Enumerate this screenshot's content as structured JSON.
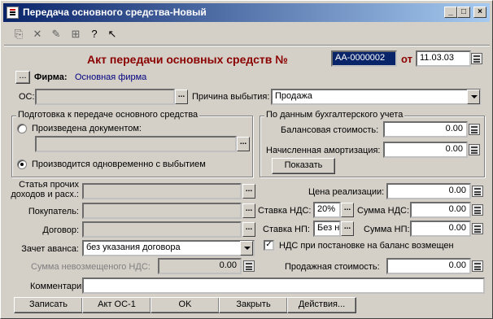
{
  "window": {
    "title": "Передача основного средства-Новый"
  },
  "toolbar": {
    "icons": [
      "copy-icon",
      "delete-icon",
      "edit-icon",
      "structure-icon",
      "help-icon",
      "whats-this-icon"
    ]
  },
  "header": {
    "doc_title": "Акт передачи основных средств №",
    "number": "АА-0000002",
    "from_label": "от",
    "date": "11.03.03"
  },
  "firm": {
    "button": "...",
    "label": "Фирма:",
    "value": "Основная фирма"
  },
  "os": {
    "label": "ОС:",
    "value": ""
  },
  "reason": {
    "label": "Причина выбытия:",
    "value": "Продажа"
  },
  "prep_group": {
    "title": "Подготовка к передаче основного средства",
    "option1": "Произведена документом:",
    "option2": "Производится одновременно с выбытием",
    "doc_value": ""
  },
  "accounting_group": {
    "title": "По данным бухгалтерского учета",
    "balance_label": "Балансовая стоимость:",
    "balance_value": "0.00",
    "amort_label": "Начисленная амортизация:",
    "amort_value": "0.00",
    "show_button": "Показать"
  },
  "left": {
    "other_label_1": "Статья прочих",
    "other_label_2": "доходов и расх.:",
    "buyer_label": "Покупатель:",
    "contract_label": "Договор:",
    "advance_label": "Зачет аванса:",
    "advance_value": "без указания договора",
    "unreimbursed_label": "Сумма невозмещеного НДС:",
    "unreimbursed_value": "0.00",
    "comment_label": "Комментарий:"
  },
  "right": {
    "sale_price_label": "Цена реализации:",
    "sale_price_value": "0.00",
    "vat_rate_label": "Ставка НДС:",
    "vat_rate_value": "20%",
    "vat_sum_label": "Сумма НДС:",
    "vat_sum_value": "0.00",
    "sales_tax_rate_label": "Ставка НП:",
    "sales_tax_rate_value": "Без н",
    "sales_tax_sum_label": "Сумма НП:",
    "sales_tax_sum_value": "0.00",
    "vat_checkbox_label": "НДС при постановке на баланс возмещен",
    "sale_cost_label": "Продажная стоимость:",
    "sale_cost_value": "0.00"
  },
  "buttons": {
    "record": "Записать",
    "act": "Акт ОС-1",
    "ok": "OK",
    "close": "Закрыть",
    "actions": "Действия..."
  }
}
